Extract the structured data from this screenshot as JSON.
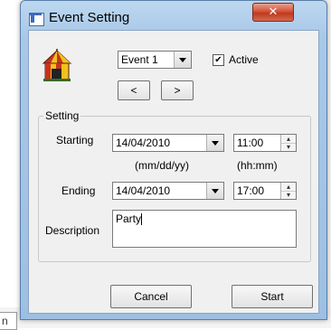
{
  "background": {
    "tab_text": "n"
  },
  "window": {
    "title": "Event Setting",
    "close_label": "✕"
  },
  "event": {
    "selected": "Event 1",
    "active_label": "Active",
    "active_checked": true,
    "prev_label": "<",
    "next_label": ">"
  },
  "setting": {
    "group_title": "Setting",
    "starting_label": "Starting",
    "starting_date": "14/04/2010",
    "starting_time": "11:00",
    "date_hint": "(mm/dd/yy)",
    "time_hint": "(hh:mm)",
    "ending_label": "Ending",
    "ending_date": "14/04/2010",
    "ending_time": "17:00",
    "description_label": "Description",
    "description_value": "Party"
  },
  "buttons": {
    "cancel": "Cancel",
    "start": "Start"
  },
  "icons": {
    "app": "window-app-icon",
    "event": "carousel-tent-icon",
    "check_mark": "✔",
    "spin_up": "▴",
    "spin_down": "▾"
  }
}
